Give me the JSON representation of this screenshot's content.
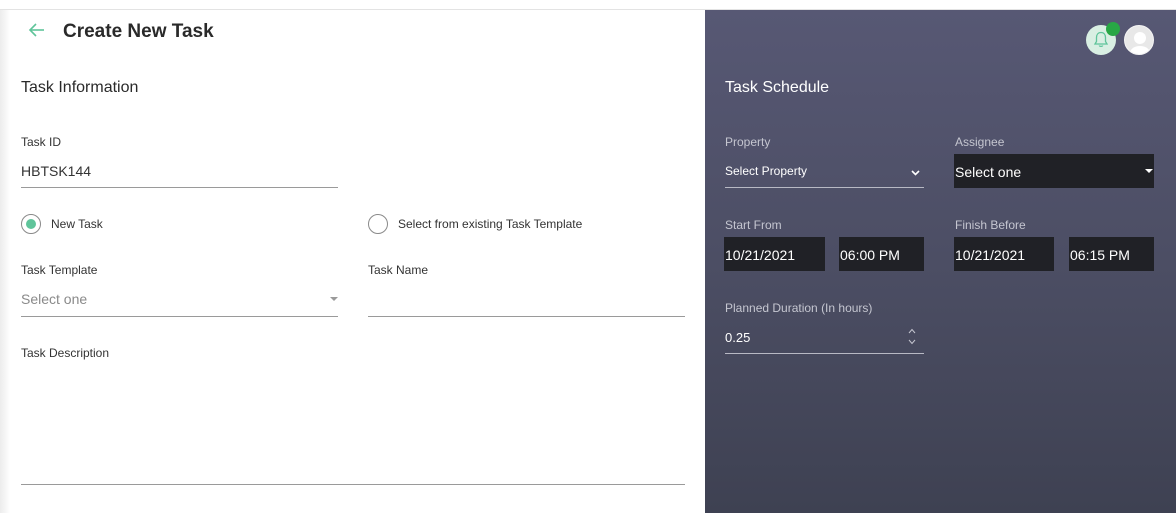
{
  "header": {
    "title": "Create New Task"
  },
  "task_information": {
    "section_title": "Task Information",
    "task_id": {
      "label": "Task ID",
      "value": "HBTSK144"
    },
    "task_type": {
      "options": [
        {
          "label": "New Task",
          "selected": true
        },
        {
          "label": "Select from existing Task Template",
          "selected": false
        }
      ]
    },
    "task_template": {
      "label": "Task Template",
      "placeholder": "Select one"
    },
    "task_name": {
      "label": "Task Name",
      "value": ""
    },
    "task_description": {
      "label": "Task Description",
      "value": ""
    }
  },
  "task_schedule": {
    "section_title": "Task Schedule",
    "property": {
      "label": "Property",
      "value": "Select Property"
    },
    "assignee": {
      "label": "Assignee",
      "value": "Select one"
    },
    "start_from": {
      "label": "Start From",
      "date": "10/21/2021",
      "time": "06:00 PM"
    },
    "finish_before": {
      "label": "Finish Before",
      "date": "10/21/2021",
      "time": "06:15 PM"
    },
    "planned_duration": {
      "label": "Planned Duration (In hours)",
      "value": "0.25"
    }
  },
  "topbar": {
    "notification_icon": "bell-icon",
    "avatar_icon": "user-avatar-icon"
  },
  "colors": {
    "accent": "#5fc49a",
    "notification_dot": "#28a745",
    "schedule_panel": "#4c4e64",
    "dark_field": "#202126"
  }
}
